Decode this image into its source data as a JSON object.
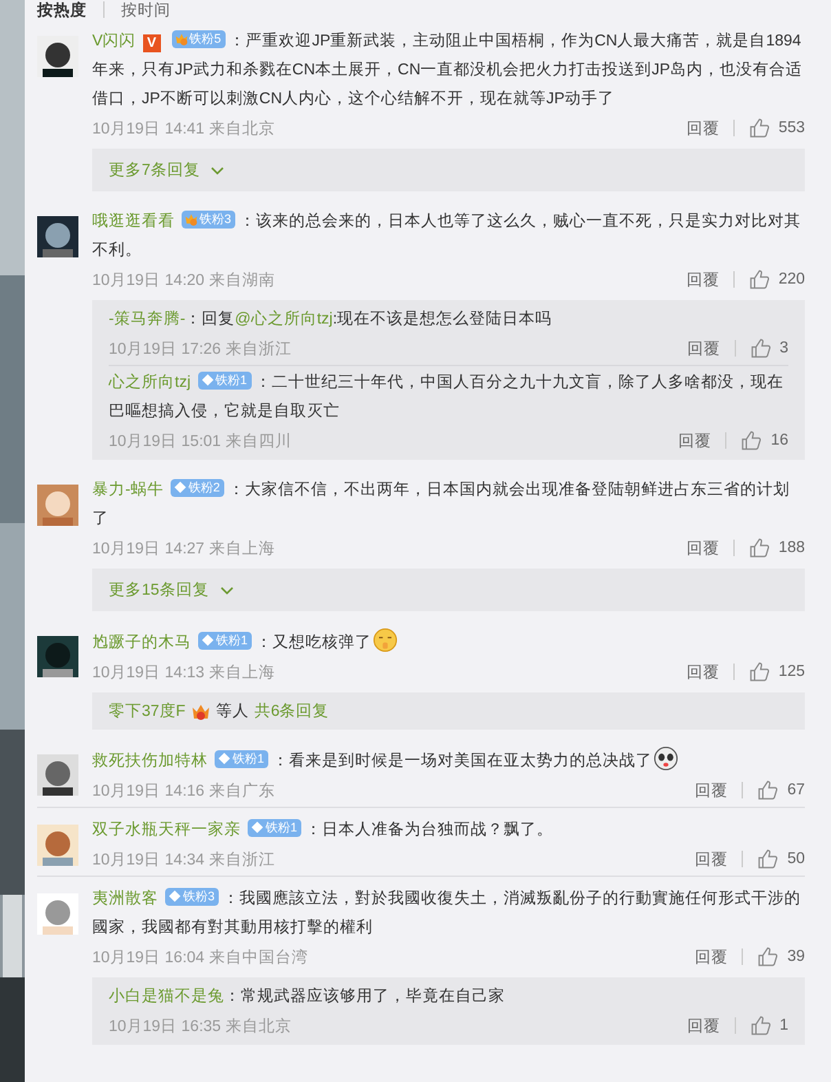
{
  "sort_tabs": [
    {
      "label": "按热度",
      "selected": true
    },
    {
      "label": "按时间",
      "selected": false
    }
  ],
  "comments": [
    {
      "user": "V闪闪",
      "vip": "V",
      "badge": {
        "kind": "crown",
        "label": "铁粉5"
      },
      "text": "：严重欢迎JP重新武装，主动阻止中国梧桐，作为CN人最大痛苦，就是自1894年来，只有JP武力和杀戮在CN本土展开，CN一直都没机会把火力打击投送到JP岛内，也没有合适借口，JP不断可以刺激CN人内心，这个心结解不开，现在就等JP动手了",
      "meta": "10月19日 14:41 来自北京",
      "reply_label": "回覆",
      "likes": "553",
      "thread": {
        "kind": "more",
        "label": "更多7条回复"
      }
    },
    {
      "user": "哦逛逛看看",
      "badge": {
        "kind": "crown",
        "label": "铁粉3"
      },
      "text": "：该来的总会来的，日本人也等了这么久，贼心一直不死，只是实力对比对其不利。",
      "meta": "10月19日 14:20 来自湖南",
      "reply_label": "回覆",
      "likes": "220",
      "thread": {
        "kind": "replies",
        "replies": [
          {
            "user": "-策马奔腾-",
            "prefix": "：回复",
            "mention": "@心之所向tzj",
            "text": ":现在不该是想怎么登陆日本吗",
            "meta": "10月19日 17:26 来自浙江",
            "reply_label": "回覆",
            "likes": "3"
          },
          {
            "user": "心之所向tzj",
            "badge": {
              "kind": "diamond",
              "label": "铁粉1"
            },
            "text": "：二十世纪三十年代，中国人百分之九十九文盲，除了人多啥都没，现在巴嘔想搞入侵，它就是自取灭亡",
            "meta": "10月19日 15:01 来自四川",
            "reply_label": "回覆",
            "likes": "16"
          }
        ]
      }
    },
    {
      "user": "暴力-蜗牛",
      "badge": {
        "kind": "diamond",
        "label": "铁粉2"
      },
      "text": "：大家信不信，不出两年，日本国内就会出现准备登陆朝鲜进占东三省的计划了",
      "meta": "10月19日 14:27 来自上海",
      "reply_label": "回覆",
      "likes": "188",
      "thread": {
        "kind": "more",
        "label": "更多15条回复"
      }
    },
    {
      "user": "尥蹶子的木马",
      "badge": {
        "kind": "diamond",
        "label": "铁粉1"
      },
      "text": "：又想吃核弹了",
      "emoji": {
        "kind": "shush"
      },
      "meta": "10月19日 14:13 来自上海",
      "reply_label": "回覆",
      "likes": "125",
      "thread": {
        "kind": "summary",
        "user": "零下37度F",
        "after": "等人",
        "count": "共6条回复"
      }
    },
    {
      "user": "救死扶伤加特林",
      "badge": {
        "kind": "diamond",
        "label": "铁粉1"
      },
      "text": "：看来是到时候是一场对美国在亚太势力的总决战了",
      "emoji": {
        "kind": "panda"
      },
      "meta": "10月19日 14:16 来自广东",
      "reply_label": "回覆",
      "likes": "67"
    },
    {
      "user": "双子水瓶天秤一家亲",
      "badge": {
        "kind": "diamond",
        "label": "铁粉1"
      },
      "text": "：日本人准备为台独而战？飘了。",
      "meta": "10月19日 14:34 来自浙江",
      "reply_label": "回覆",
      "likes": "50"
    },
    {
      "user": "夷洲散客",
      "badge": {
        "kind": "diamond",
        "label": "铁粉3"
      },
      "text": "：我國應該立法，對於我國收復失土，消滅叛亂份子的行動實施任何形式干涉的國家，我國都有對其動用核打擊的權利",
      "meta": "10月19日 16:04 来自中国台湾",
      "reply_label": "回覆",
      "likes": "39",
      "thread": {
        "kind": "replies",
        "replies": [
          {
            "user": "小白是猫不是兔",
            "text": "：常规武器应该够用了，毕竟在自己家",
            "meta": "10月19日 16:35 来自北京",
            "reply_label": "回覆",
            "likes": "1"
          }
        ]
      }
    }
  ]
}
